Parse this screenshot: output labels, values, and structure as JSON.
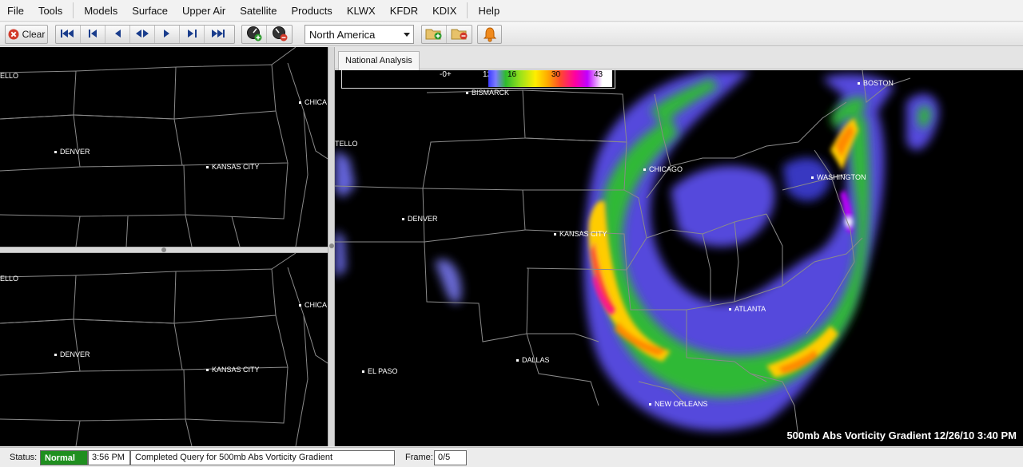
{
  "menu": [
    "File",
    "Tools",
    "Models",
    "Surface",
    "Upper Air",
    "Satellite",
    "Products",
    "KLWX",
    "KFDR",
    "KDIX",
    "Help"
  ],
  "toolbar": {
    "clear_label": "Clear",
    "region_value": "North America",
    "icons": [
      "clear-icon",
      "first-frame-icon",
      "step-back-icon",
      "back-icon",
      "loop-icon",
      "forward-icon",
      "step-forward-icon",
      "last-frame-icon",
      "speed-up-icon",
      "speed-down-icon",
      "add-folder-icon",
      "remove-folder-icon",
      "alert-bell-icon"
    ]
  },
  "tabs": [
    "National Analysis"
  ],
  "maps": {
    "small_cities": [
      "ELLO",
      "DENVER",
      "CHICA",
      "KANSAS CITY"
    ],
    "main_cities": [
      "BISMARCK",
      "BOSTON",
      "TELLO",
      "CHICAGO",
      "WASHINGTON",
      "DENVER",
      "KANSAS CITY",
      "ATLANTA",
      "DALLAS",
      "EL PASO",
      "NEW ORLEANS"
    ],
    "legend": {
      "values": [
        "-0+",
        "12",
        "16",
        "30",
        "43"
      ],
      "colors": [
        "#3b3bff",
        "#2dbb2d",
        "#9be21a",
        "#ffee00",
        "#ffaa00",
        "#ff4a2a",
        "#ff00a0",
        "#c000ff",
        "#ffffff"
      ]
    },
    "caption": "500mb Abs Vorticity Gradient  12/26/10 3:40 PM"
  },
  "status": {
    "label": "Status:",
    "state": "Normal",
    "state_color": "#1f8f1f",
    "time": "3:56 PM",
    "message": "Completed Query for 500mb Abs Vorticity Gradient",
    "frame_label": "Frame:",
    "frame_value": "0/5"
  }
}
